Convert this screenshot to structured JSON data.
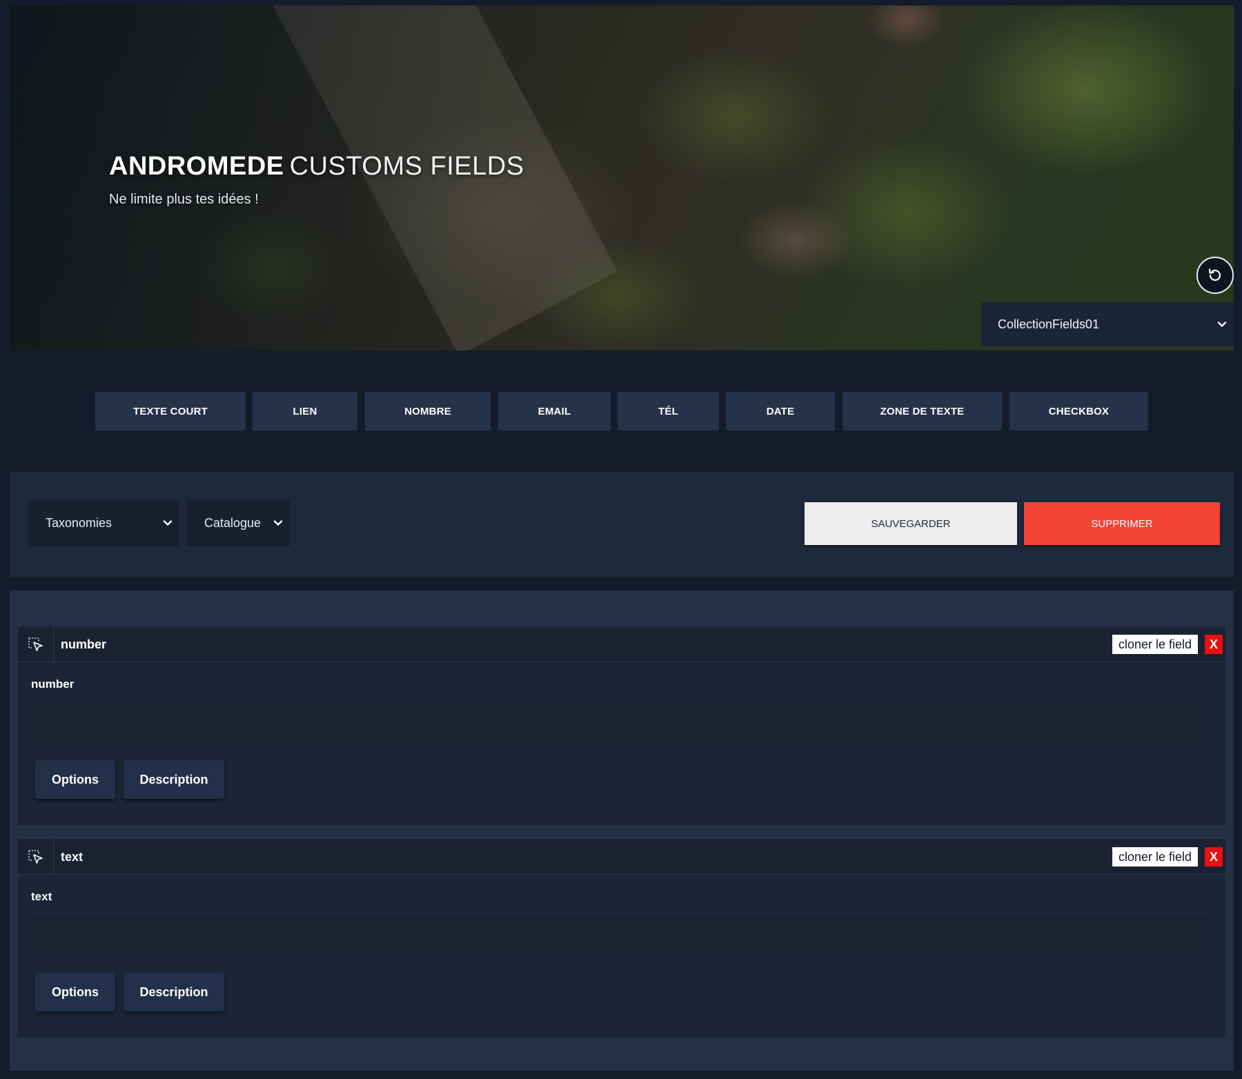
{
  "hero": {
    "title_strong": "ANDROMEDE",
    "title_light": "CUSTOMS FIELDS",
    "subtitle": "Ne limite plus tes idées !",
    "collection_select": {
      "selected": "CollectionFields01"
    }
  },
  "field_types": [
    "TEXTE COURT",
    "LIEN",
    "NOMBRE",
    "EMAIL",
    "TÉL",
    "DATE",
    "ZONE DE TEXTE",
    "CHECKBOX"
  ],
  "toolbar": {
    "taxonomy_select": "Taxonomies",
    "catalogue_select": "Catalogue",
    "save_label": "SAUVEGARDER",
    "delete_label": "SUPPRIMER"
  },
  "fields": [
    {
      "name": "number",
      "label": "number",
      "clone_label": "cloner le field",
      "delete_label": "X",
      "options_label": "Options",
      "description_label": "Description"
    },
    {
      "name": "text",
      "label": "text",
      "clone_label": "cloner le field",
      "delete_label": "X",
      "options_label": "Options",
      "description_label": "Description"
    }
  ],
  "colors": {
    "background": "#141c2c",
    "type_button": "#24324a",
    "delete_button": "#f44336",
    "field_delete": "#e81010"
  },
  "icons": {
    "refresh": "refresh-icon",
    "chevron": "chevron-down-icon",
    "drag": "drag-cursor-icon"
  }
}
